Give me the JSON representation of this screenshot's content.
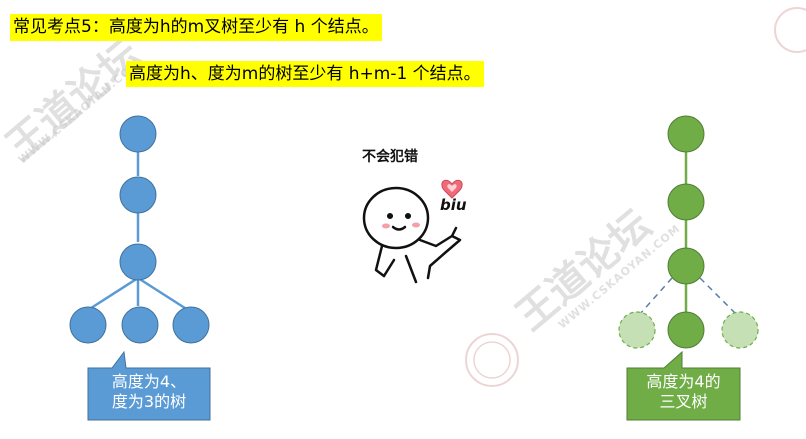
{
  "headline": {
    "line1": "常见考点5：高度为h的m叉树至少有 h 个结点。",
    "line2": "高度为h、度为m的树至少有 h+m-1 个结点。"
  },
  "left_tree": {
    "caption_line1": "高度为4、",
    "caption_line2": "度为3的树",
    "node_color": "#5b9bd5",
    "caption_bg": "#5b9bd5"
  },
  "right_tree": {
    "caption_line1": "高度为4的",
    "caption_line2": "三叉树",
    "node_color": "#70ad47",
    "ghost_color": "#c5e0b4",
    "caption_bg": "#70ad47"
  },
  "meme": {
    "caption": "不会犯错",
    "sound_text": "biu"
  },
  "watermark": {
    "main": "王道论坛",
    "url": "WWW.CSKAOYAN.COM"
  }
}
